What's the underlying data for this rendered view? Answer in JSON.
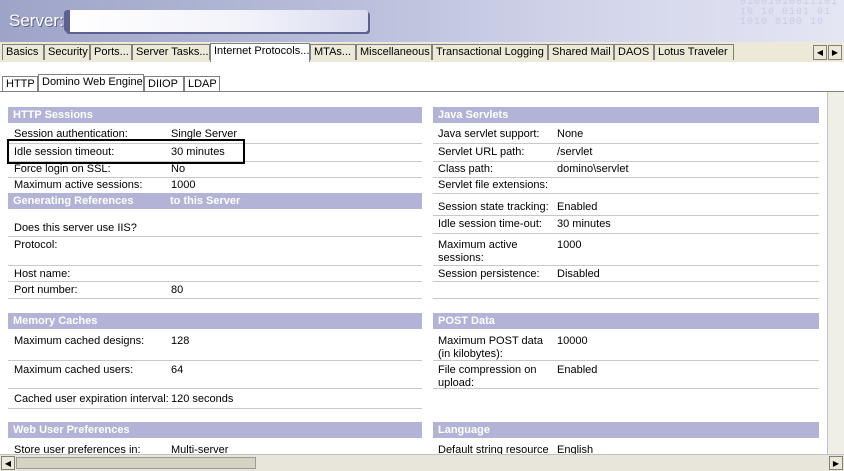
{
  "header": {
    "title": "Server:",
    "binary_text": "01001010011101\n10 10 0101 01\n1010 0100 10"
  },
  "main_tabs": [
    {
      "label": "Basics"
    },
    {
      "label": "Security"
    },
    {
      "label": "Ports..."
    },
    {
      "label": "Server Tasks..."
    },
    {
      "label": "Internet Protocols..."
    },
    {
      "label": "MTAs..."
    },
    {
      "label": "Miscellaneous"
    },
    {
      "label": "Transactional Logging"
    },
    {
      "label": "Shared Mail"
    },
    {
      "label": "DAOS"
    },
    {
      "label": "Lotus Traveler"
    }
  ],
  "sub_tabs": [
    {
      "label": "HTTP"
    },
    {
      "label": "Domino Web Engine"
    },
    {
      "label": "DIIOP"
    },
    {
      "label": "LDAP"
    }
  ],
  "sections": {
    "http_sessions": {
      "title": "HTTP Sessions",
      "rows": [
        {
          "label": "Session authentication:",
          "value": "Single Server"
        },
        {
          "label": "Idle session timeout:",
          "value": "30 minutes"
        },
        {
          "label": "Force login on SSL:",
          "value": "No"
        },
        {
          "label": "Maximum active sessions:",
          "value": "1000"
        }
      ]
    },
    "generating_references": {
      "title": "Generating References",
      "title2": "to this Server",
      "rows": [
        {
          "label": "Does this server use IIS?",
          "value": ""
        },
        {
          "label": "Protocol:",
          "value": ""
        },
        {
          "label": "Host name:",
          "value": ""
        },
        {
          "label": "Port number:",
          "value": "80"
        }
      ]
    },
    "memory_caches": {
      "title": "Memory Caches",
      "rows": [
        {
          "label": "Maximum cached designs:",
          "value": "128"
        },
        {
          "label": "Maximum cached users:",
          "value": "64"
        },
        {
          "label": "Cached user expiration interval:",
          "value": "120 seconds"
        }
      ]
    },
    "web_user_preferences": {
      "title": "Web User Preferences",
      "rows": [
        {
          "label": "Store user preferences in:",
          "value": "Multi-server"
        }
      ]
    },
    "java_servlets": {
      "title": "Java Servlets",
      "rows": [
        {
          "label": "Java servlet support:",
          "value": "None"
        },
        {
          "label": "Servlet URL path:",
          "value": "/servlet"
        },
        {
          "label": "Class path:",
          "value": "domino\\servlet"
        },
        {
          "label": "Servlet file extensions:",
          "value": ""
        },
        {
          "label": "Session state tracking:",
          "value": "Enabled"
        },
        {
          "label": "Idle session time-out:",
          "value": "30 minutes"
        },
        {
          "label": "Maximum active sessions:",
          "value": "1000"
        },
        {
          "label": "Session persistence:",
          "value": "Disabled"
        }
      ]
    },
    "post_data": {
      "title": "POST Data",
      "rows": [
        {
          "label": "Maximum POST data (in kilobytes):",
          "value": "10000"
        },
        {
          "label": "File compression on upload:",
          "value": "Enabled"
        }
      ]
    },
    "language": {
      "title": "Language",
      "rows": [
        {
          "label": "Default string resource",
          "value": "English"
        }
      ]
    }
  }
}
